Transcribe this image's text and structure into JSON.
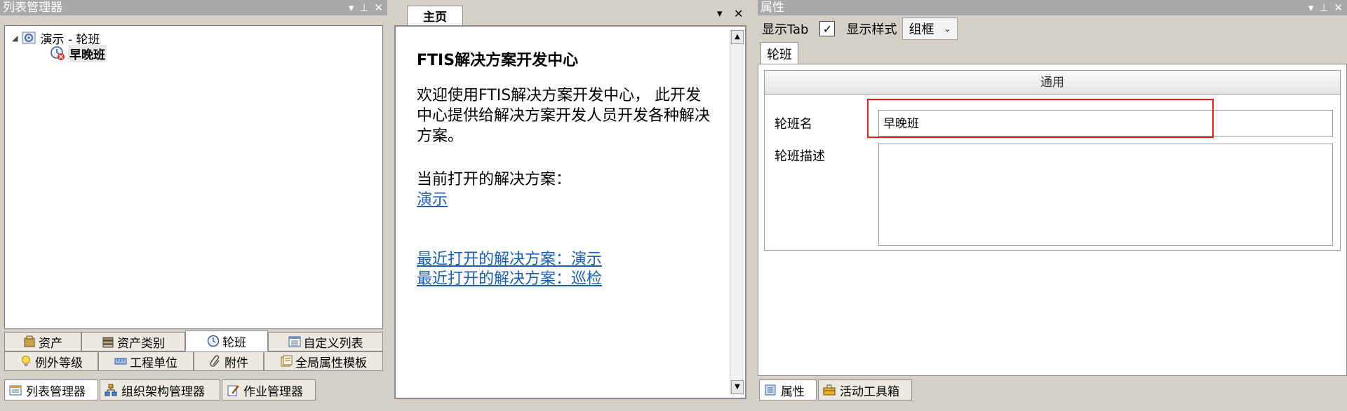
{
  "left_panel": {
    "title": "列表管理器",
    "tree": {
      "root_label": "演示 - 轮班",
      "child_label": "早晚班"
    },
    "tabs_row1": [
      "资产",
      "资产类别",
      "轮班",
      "自定义列表"
    ],
    "tabs_row2": [
      "例外等级",
      "工程单位",
      "附件",
      "全局属性模板"
    ],
    "bottom_tabs": [
      "列表管理器",
      "组织架构管理器",
      "作业管理器"
    ]
  },
  "center_panel": {
    "tab_label": "主页",
    "heading": "FTIS解决方案开发中心",
    "intro": "欢迎使用FTIS解决方案开发中心， 此开发中心提供给解决方案开发人员开发各种解决方案。",
    "current_label": "当前打开的解决方案：",
    "current_link": "演示",
    "recent_links": [
      "最近打开的解决方案：演示",
      "最近打开的解决方案：巡检"
    ]
  },
  "right_panel": {
    "title": "属性",
    "show_tab_label": "显示Tab",
    "show_tab_checked": true,
    "show_style_label": "显示样式",
    "style_value": "组框",
    "prop_tab": "轮班",
    "group_title": "通用",
    "name_label": "轮班名",
    "name_value": "早晚班",
    "desc_label": "轮班描述",
    "desc_value": "",
    "bottom_tabs": [
      "属性",
      "活动工具箱"
    ]
  }
}
